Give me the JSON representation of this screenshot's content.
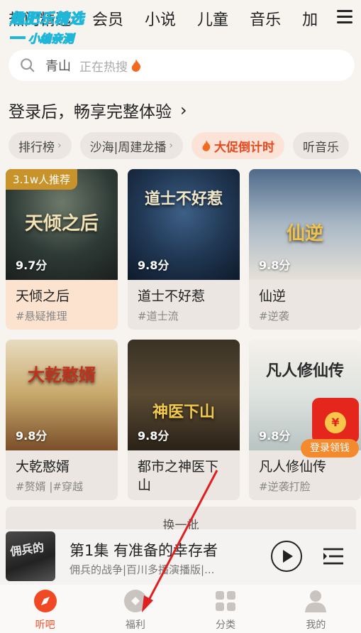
{
  "tabs": [
    "热门精选",
    "会员",
    "小说",
    "儿童",
    "音乐",
    "加"
  ],
  "watermark": {
    "line1": "趣肥乐精选",
    "line2": "小编亲测"
  },
  "search": {
    "keyword": "青山",
    "hint": "正在热搜"
  },
  "login_banner": {
    "text": "登录后，畅享完整体验",
    "chevron": "›"
  },
  "chips": [
    {
      "label": "排行榜",
      "arrow": "›"
    },
    {
      "label": "沙海|周建龙播",
      "arrow": "›"
    },
    {
      "label": "大促倒计时",
      "promo": true
    },
    {
      "label": "听音乐"
    }
  ],
  "cards": [
    {
      "name": "天倾之后",
      "tags": "#悬疑推理",
      "score": "9.7分",
      "badge": "3.1w人推荐",
      "cover_title": "天倾之后",
      "highlight": true
    },
    {
      "name": "道士不好惹",
      "tags": "#道士流",
      "score": "9.8分",
      "cover_title": "道士不好惹"
    },
    {
      "name": "仙逆",
      "tags": "#逆袭",
      "score": "9.8分",
      "cover_title": "仙逆"
    },
    {
      "name": "大乾憨婿",
      "tags": "#赘婿 |#穿越",
      "score": "9.8分",
      "cover_title": "大乾憨婿"
    },
    {
      "name": "都市之神医下山",
      "tags": "",
      "score": "9.8分",
      "cover_title": "神医下山"
    },
    {
      "name": "凡人修仙传",
      "tags": "#逆袭打脸",
      "score": "9.8分",
      "cover_title": "凡人修仙传"
    }
  ],
  "envelope": {
    "coin": "¥",
    "label": "登录领钱"
  },
  "refresh": {
    "label": "换一批"
  },
  "player": {
    "episode": "第1集 有准备的幸存者",
    "subtitle": "佣兵的战争|百川多播演播版|...",
    "thumb_text": "佣兵的"
  },
  "nav": [
    {
      "label": "听吧",
      "icon": "compass-icon",
      "active": true
    },
    {
      "label": "福利",
      "icon": "gift-diamond-icon"
    },
    {
      "label": "分类",
      "icon": "grid-icon"
    },
    {
      "label": "我的",
      "icon": "user-icon"
    }
  ],
  "colors": {
    "accent": "#f04a24",
    "promo": "#e84a1e",
    "arrow": "#e02020"
  }
}
